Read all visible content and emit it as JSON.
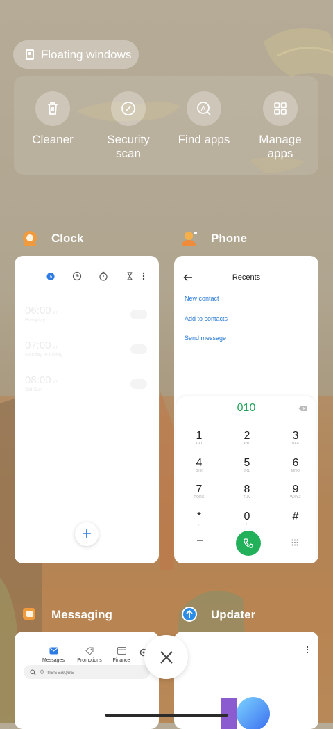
{
  "floating_windows": {
    "label": "Floating windows",
    "icon": "floating-window-icon"
  },
  "tools": [
    {
      "label": "Cleaner",
      "icon": "trash-icon"
    },
    {
      "label": "Security\nscan",
      "icon": "security-scan-icon"
    },
    {
      "label": "Find apps",
      "icon": "find-apps-icon"
    },
    {
      "label": "Manage\napps",
      "icon": "grid-icon"
    }
  ],
  "apps": {
    "clock": {
      "title": "Clock",
      "alarms": [
        {
          "time": "06:00",
          "ampm": "am",
          "repeat": "Everyday"
        },
        {
          "time": "07:00",
          "ampm": "am",
          "repeat": "Monday to Friday"
        },
        {
          "time": "08:00",
          "ampm": "am",
          "repeat": "Sat Sun"
        }
      ],
      "add_symbol": "+"
    },
    "phone": {
      "title": "Phone",
      "screen_title": "Recents",
      "links": [
        "New contact",
        "Add to contacts",
        "Send message"
      ],
      "dial_number": "010",
      "keys": [
        {
          "d": "1",
          "l": "GO"
        },
        {
          "d": "2",
          "l": "ABC"
        },
        {
          "d": "3",
          "l": "DEF"
        },
        {
          "d": "4",
          "l": "GHI"
        },
        {
          "d": "5",
          "l": "JKL"
        },
        {
          "d": "6",
          "l": "MNO"
        },
        {
          "d": "7",
          "l": "PQRS"
        },
        {
          "d": "8",
          "l": "TUV"
        },
        {
          "d": "9",
          "l": "WXYZ"
        },
        {
          "d": "*",
          "l": ","
        },
        {
          "d": "0",
          "l": "+"
        },
        {
          "d": "#",
          "l": ""
        }
      ]
    },
    "messaging": {
      "title": "Messaging",
      "tabs": [
        "Messages",
        "Promotions",
        "Finance"
      ],
      "search_placeholder": "0 messages"
    },
    "updater": {
      "title": "Updater"
    }
  },
  "colors": {
    "accent_blue": "#2a7ad6",
    "call_green": "#22b05b",
    "dial_green": "#1fa35a"
  }
}
